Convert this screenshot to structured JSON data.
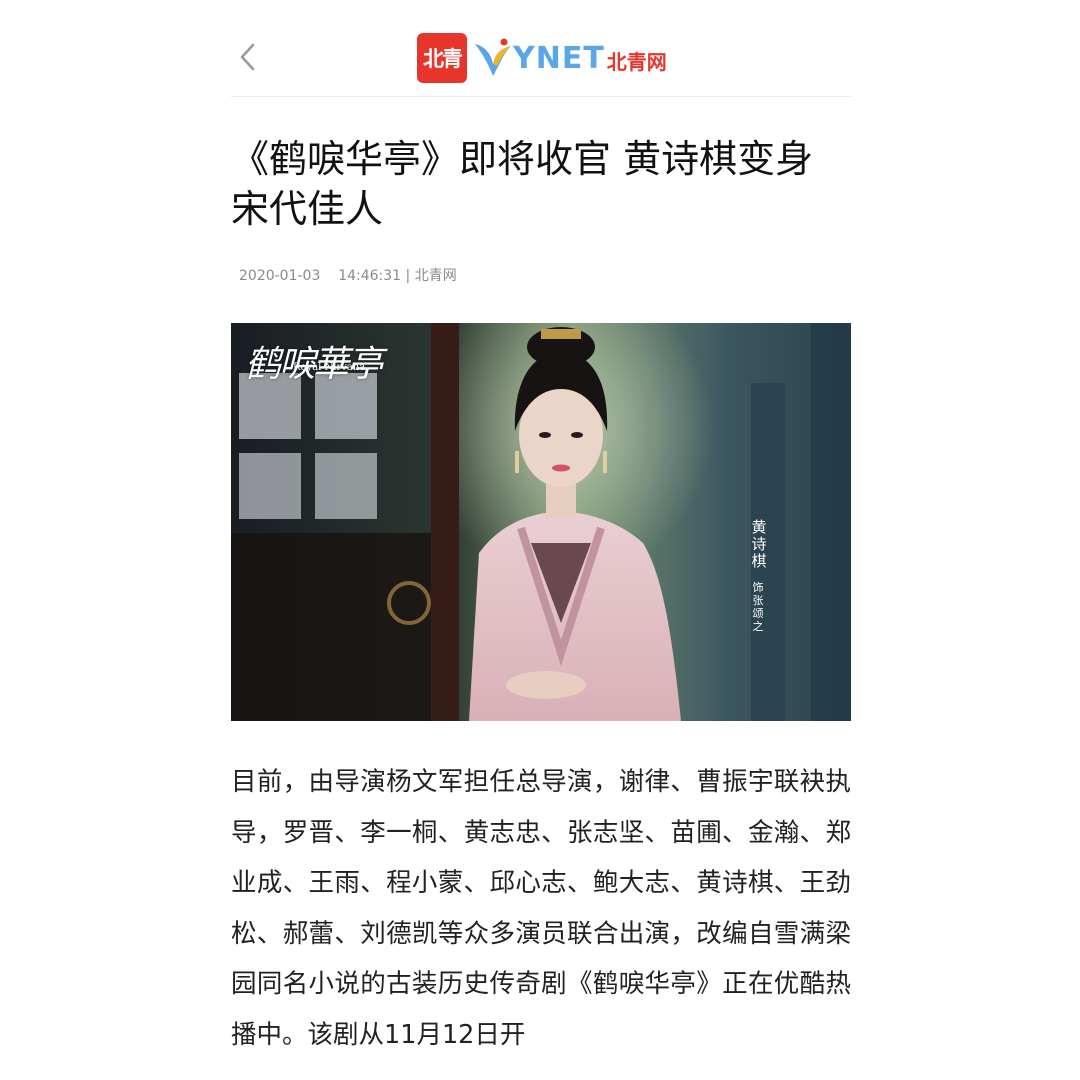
{
  "header": {
    "back_icon": "chevron-left-icon",
    "logo_badge": "北青",
    "logo_latin": "YNET",
    "logo_cn": "北青网"
  },
  "article": {
    "title": "《鹤唳华亭》即将收官 黄诗棋变身宋代佳人",
    "date": "2020-01-03",
    "time": "14:46:31",
    "separator": "|",
    "source": "北青网",
    "image": {
      "show_title": "鹤唳華亭",
      "show_title_en": "Royal Nirvana",
      "actor": "黄诗棋",
      "role_mark": "饰",
      "role": "张颂之"
    },
    "body": "目前，由导演杨文军担任总导演，谢律、曹振宇联袂执导，罗晋、李一桐、黄志忠、张志坚、苗圃、金瀚、郑业成、王雨、程小蒙、邱心志、鲍大志、黄诗棋、王劲松、郝蕾、刘德凯等众多演员联合出演，改编自雪满梁园同名小说的古装历史传奇剧《鹤唳华亭》正在优酷热播中。该剧从11月12日开"
  },
  "colors": {
    "brand_red": "#e8352b",
    "brand_blue": "#5aa6e8",
    "meta_gray": "#8a8a8a"
  }
}
